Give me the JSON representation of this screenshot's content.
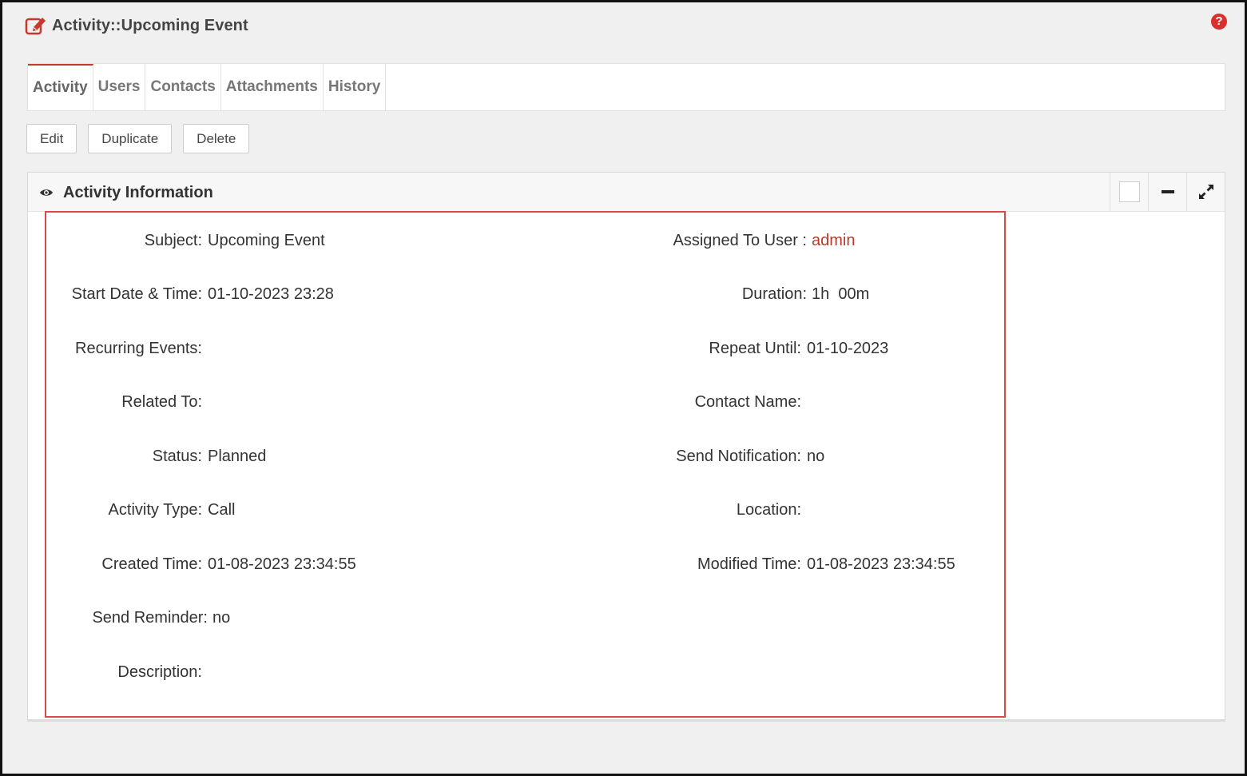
{
  "header": {
    "title": "Activity::Upcoming Event",
    "help_icon": "question-circle-icon"
  },
  "tabs": [
    {
      "label": "Activity",
      "active": true
    },
    {
      "label": "Users"
    },
    {
      "label": "Contacts"
    },
    {
      "label": "Attachments"
    },
    {
      "label": "History"
    }
  ],
  "actions": {
    "edit": "Edit",
    "duplicate": "Duplicate",
    "delete": "Delete"
  },
  "panel": {
    "title": "Activity Information",
    "title_icon": "eye-icon",
    "tools": [
      "checkbox",
      "minus-icon",
      "expand-icon"
    ]
  },
  "fields": {
    "subject": {
      "label": "Subject:",
      "value": "Upcoming Event"
    },
    "assigned_to": {
      "label": "Assigned To User :",
      "value": "admin"
    },
    "start_date": {
      "label": "Start Date & Time:",
      "value": "01-10-2023 23:28"
    },
    "duration": {
      "label": "Duration:",
      "value": "1h  00m"
    },
    "recurring": {
      "label": "Recurring Events:",
      "value": ""
    },
    "repeat_until": {
      "label": "Repeat Until:",
      "value": "01-10-2023"
    },
    "related_to": {
      "label": "Related To:",
      "value": ""
    },
    "contact_name": {
      "label": "Contact Name:",
      "value": ""
    },
    "status": {
      "label": "Status:",
      "value": "Planned"
    },
    "send_notification": {
      "label": "Send Notification:",
      "value": "no"
    },
    "activity_type": {
      "label": "Activity Type:",
      "value": "Call"
    },
    "location": {
      "label": "Location:",
      "value": ""
    },
    "created_time": {
      "label": "Created Time:",
      "value": "01-08-2023 23:34:55"
    },
    "modified_time": {
      "label": "Modified Time:",
      "value": "01-08-2023 23:34:55"
    },
    "send_reminder": {
      "label": "Send Reminder:",
      "value": "no"
    },
    "description": {
      "label": "Description:",
      "value": ""
    }
  },
  "colors": {
    "accent": "#c23b2e",
    "link": "#b63a2b",
    "highlight_border": "#d9484f"
  }
}
